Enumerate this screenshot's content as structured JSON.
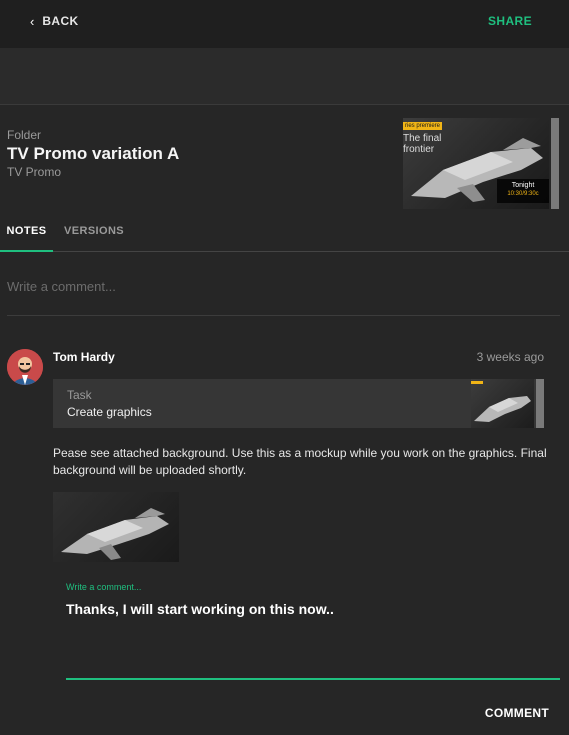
{
  "topbar": {
    "back_label": "BACK",
    "share_label": "SHARE"
  },
  "asset": {
    "folder_label": "Folder",
    "title": "TV Promo variation A",
    "parent": "TV Promo",
    "thumbnail": {
      "badge": "ries premiere",
      "line1": "The final",
      "line2": "frontier",
      "tonight": "Tonight",
      "showtime": "10:30/9:30c"
    }
  },
  "tabs": [
    {
      "label": "NOTES",
      "active": true
    },
    {
      "label": "VERSIONS",
      "active": false
    }
  ],
  "comment_box": {
    "placeholder": "Write a comment..."
  },
  "note": {
    "author": "Tom Hardy",
    "time": "3 weeks ago",
    "task": {
      "label": "Task",
      "name": "Create graphics"
    },
    "body": "Pease see attached background. Use this as a mockup while you work on the graphics. Final background will be uploaded shortly.",
    "reply": {
      "label": "Write a comment...",
      "text": "Thanks, I will start working on this now..",
      "submit_label": "COMMENT"
    }
  },
  "colors": {
    "accent": "#1fbf7f",
    "background": "#262626",
    "topbar": "#1f1f1f",
    "card": "#363636",
    "badge": "#f0b416"
  },
  "icons": {
    "back": "chevron-left-icon",
    "avatar": "user-avatar"
  }
}
